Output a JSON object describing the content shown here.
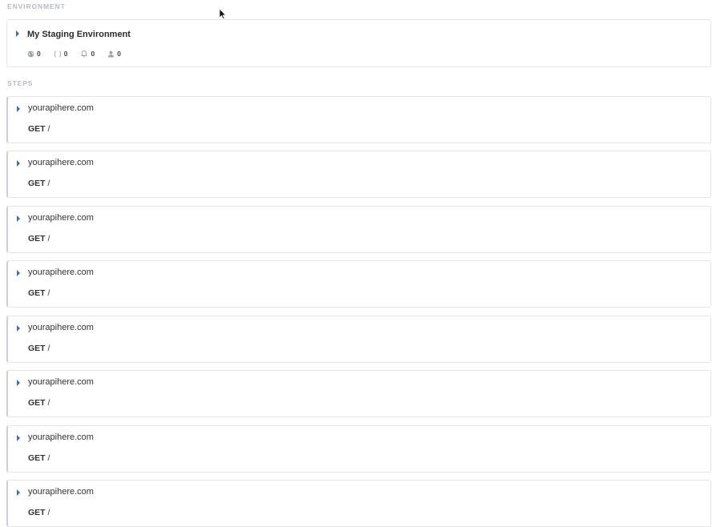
{
  "environment": {
    "section_label": "ENVIRONMENT",
    "name": "My Staging Environment",
    "stats": [
      {
        "icon": "globe-icon",
        "value": "0"
      },
      {
        "icon": "braces-icon",
        "value": "0"
      },
      {
        "icon": "bell-icon",
        "value": "0"
      },
      {
        "icon": "user-icon",
        "value": "0"
      }
    ]
  },
  "steps": {
    "section_label": "STEPS",
    "items": [
      {
        "host": "yourapihere.com",
        "method": "GET",
        "path": "/"
      },
      {
        "host": "yourapihere.com",
        "method": "GET",
        "path": "/"
      },
      {
        "host": "yourapihere.com",
        "method": "GET",
        "path": "/"
      },
      {
        "host": "yourapihere.com",
        "method": "GET",
        "path": "/"
      },
      {
        "host": "yourapihere.com",
        "method": "GET",
        "path": "/"
      },
      {
        "host": "yourapihere.com",
        "method": "GET",
        "path": "/"
      },
      {
        "host": "yourapihere.com",
        "method": "GET",
        "path": "/"
      },
      {
        "host": "yourapihere.com",
        "method": "GET",
        "path": "/"
      }
    ]
  },
  "colors": {
    "accent": "#3a6fb0",
    "border": "#e3e6ea",
    "label": "#b5bcc4"
  }
}
